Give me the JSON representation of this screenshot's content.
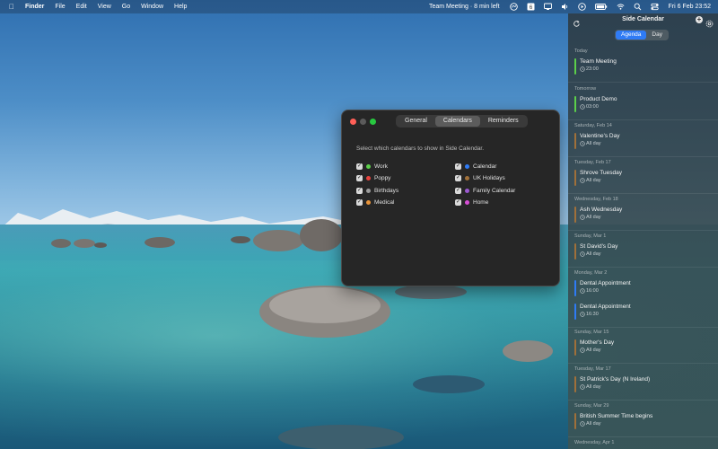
{
  "menubar": {
    "app_name": "Finder",
    "menus": [
      "File",
      "Edit",
      "View",
      "Go",
      "Window",
      "Help"
    ],
    "next_meeting": "Team Meeting · 8 min left",
    "clock": "Fri 6 Feb  23:52"
  },
  "settings": {
    "tabs": [
      "General",
      "Calendars",
      "Reminders"
    ],
    "active_tab": "Calendars",
    "description": "Select which calendars to show in Side Calendar.",
    "calendars_left": [
      {
        "name": "Work",
        "color": "#5ccf4a",
        "checked": true
      },
      {
        "name": "Poppy",
        "color": "#e8433d",
        "checked": true
      },
      {
        "name": "Birthdays",
        "color": "#9a9a9a",
        "checked": true
      },
      {
        "name": "Medical",
        "color": "#e8943a",
        "checked": true
      }
    ],
    "calendars_right": [
      {
        "name": "Calendar",
        "color": "#2f7bf5",
        "checked": true
      },
      {
        "name": "UK Holidays",
        "color": "#a0703a",
        "checked": true
      },
      {
        "name": "Family Calendar",
        "color": "#9b59d0",
        "checked": true
      },
      {
        "name": "Home",
        "color": "#d84fd6",
        "checked": true
      }
    ]
  },
  "panel": {
    "title": "Side Calendar",
    "view_tabs": [
      "Agenda",
      "Day"
    ],
    "active_view": "Agenda",
    "days": [
      {
        "label": "Today",
        "events": [
          {
            "title": "Team Meeting",
            "time": "23:00",
            "color": "#5ccf4a"
          }
        ]
      },
      {
        "label": "Tomorrow",
        "events": [
          {
            "title": "Product Demo",
            "time": "03:00",
            "color": "#5ccf4a"
          }
        ]
      },
      {
        "label": "Saturday, Feb 14",
        "events": [
          {
            "title": "Valentine's Day",
            "time": "All day",
            "color": "#a0703a"
          }
        ]
      },
      {
        "label": "Tuesday, Feb 17",
        "events": [
          {
            "title": "Shrove Tuesday",
            "time": "All day",
            "color": "#a0703a"
          }
        ]
      },
      {
        "label": "Wednesday, Feb 18",
        "events": [
          {
            "title": "Ash Wednesday",
            "time": "All day",
            "color": "#a0703a"
          }
        ]
      },
      {
        "label": "Sunday, Mar 1",
        "events": [
          {
            "title": "St David's Day",
            "time": "All day",
            "color": "#a0703a"
          }
        ]
      },
      {
        "label": "Monday, Mar 2",
        "events": [
          {
            "title": "Dental Appointment",
            "time": "16:00",
            "color": "#2f7bf5"
          },
          {
            "title": "Dental Appointment",
            "time": "16:30",
            "color": "#2f7bf5"
          }
        ]
      },
      {
        "label": "Sunday, Mar 15",
        "events": [
          {
            "title": "Mother's Day",
            "time": "All day",
            "color": "#a0703a"
          }
        ]
      },
      {
        "label": "Tuesday, Mar 17",
        "events": [
          {
            "title": "St Patrick's Day (N Ireland)",
            "time": "All day",
            "color": "#a0703a"
          }
        ]
      },
      {
        "label": "Sunday, Mar 29",
        "events": [
          {
            "title": "British Summer Time begins",
            "time": "All day",
            "color": "#a0703a"
          }
        ]
      },
      {
        "label": "Wednesday, Apr 1",
        "events": []
      }
    ]
  }
}
